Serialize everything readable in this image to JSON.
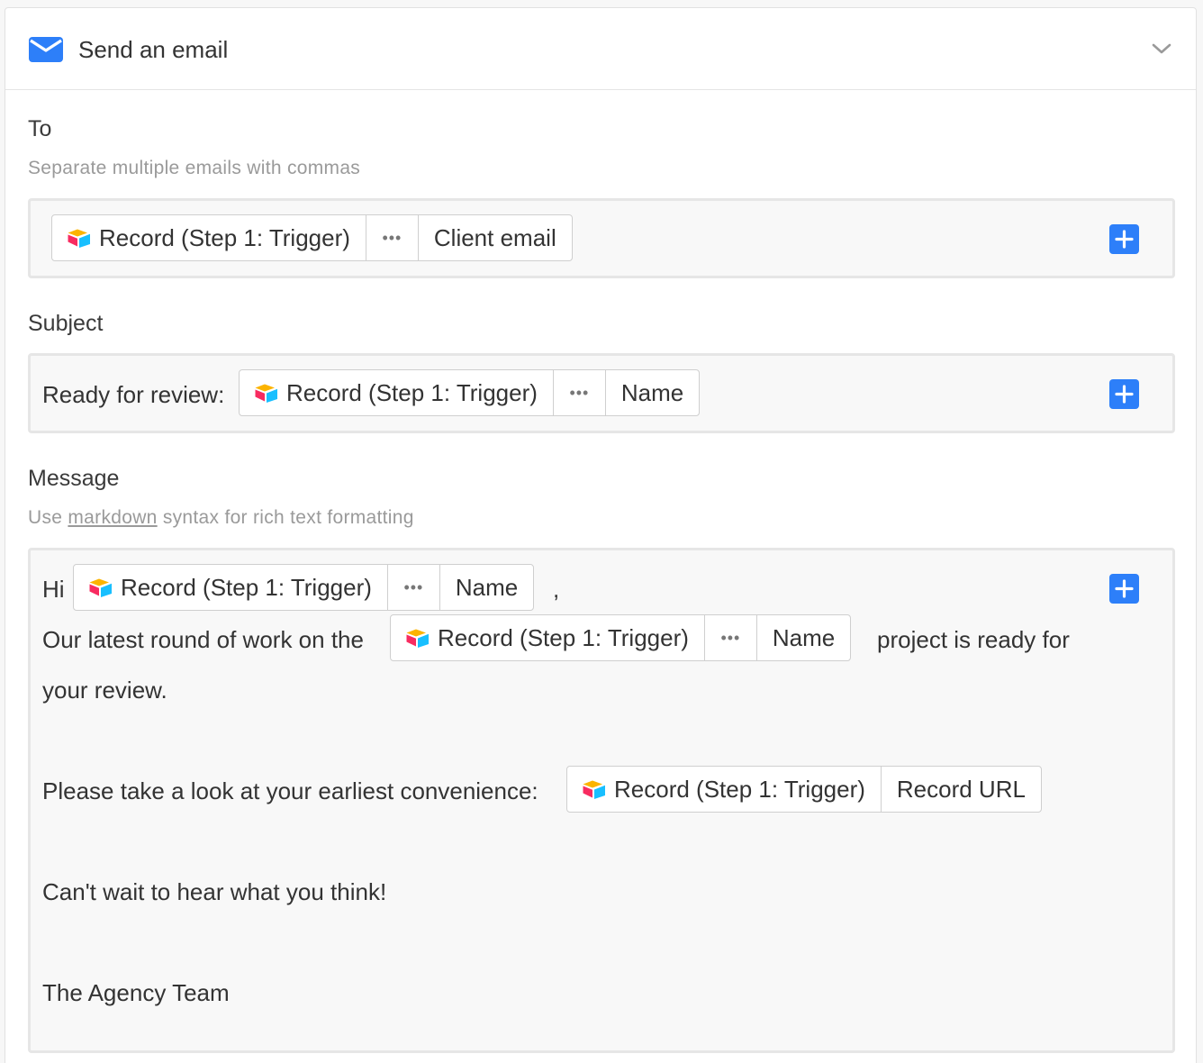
{
  "header": {
    "title": "Send an email",
    "mail_icon": "envelope-icon",
    "collapse_icon": "chevron-down-icon",
    "accent": "#2d7ff9"
  },
  "to": {
    "label": "To",
    "hint": "Separate multiple emails with commas",
    "token": {
      "source": "Record (Step 1: Trigger)",
      "more": "•••",
      "field": "Client email"
    }
  },
  "subject": {
    "label": "Subject",
    "prefix": "Ready for review:",
    "token": {
      "source": "Record (Step 1: Trigger)",
      "more": "•••",
      "field": "Name"
    }
  },
  "message": {
    "label": "Message",
    "hint_pre": "Use",
    "hint_link": "markdown",
    "hint_post": "syntax for rich text formatting",
    "line1_pre": "Hi",
    "line1_token": {
      "source": "Record (Step 1: Trigger)",
      "more": "•••",
      "field": "Name"
    },
    "line1_post": ",",
    "line2_pre": "Our latest round of work on the",
    "line2_token": {
      "source": "Record (Step 1: Trigger)",
      "more": "•••",
      "field": "Name"
    },
    "line2_post": "project is ready for",
    "line3": "your review.",
    "line4_pre": "Please take a look at your earliest convenience:",
    "line4_token": {
      "source": "Record (Step 1: Trigger)",
      "field": "Record URL"
    },
    "line5": "Can't wait to hear what you think!",
    "line6": "The Agency Team"
  },
  "insert_button_icon": "plus-icon"
}
